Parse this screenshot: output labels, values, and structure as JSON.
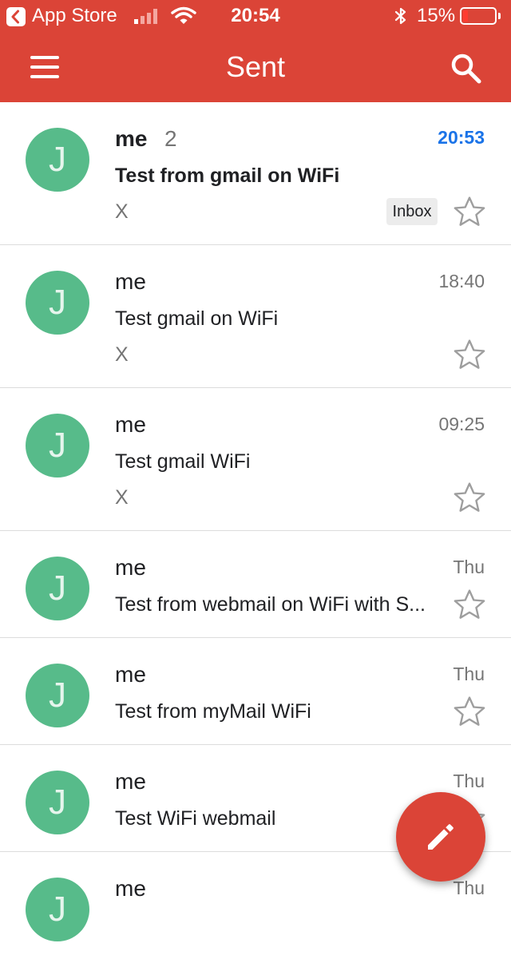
{
  "status_bar": {
    "back_app": "App Store",
    "time": "20:54",
    "battery_percent": "15%",
    "icons": [
      "back-icon",
      "signal-icon",
      "wifi-icon",
      "bluetooth-icon",
      "battery-icon"
    ]
  },
  "app_bar": {
    "title": "Sent",
    "icons": [
      "menu-icon",
      "search-icon"
    ],
    "color": "#db4437"
  },
  "emails": [
    {
      "sender": "me",
      "count": "2",
      "time": "20:53",
      "subject": "Test from gmail on WiFi",
      "snippet": "X",
      "label": "Inbox",
      "unread": true
    },
    {
      "sender": "me",
      "count": "",
      "time": "18:40",
      "subject": "Test gmail on WiFi",
      "snippet": "X",
      "label": "",
      "unread": false
    },
    {
      "sender": "me",
      "count": "",
      "time": "09:25",
      "subject": "Test gmail WiFi",
      "snippet": "X",
      "label": "",
      "unread": false
    },
    {
      "sender": "me",
      "count": "",
      "time": "Thu",
      "subject": "Test from webmail on WiFi with S...",
      "snippet": "",
      "label": "",
      "unread": false
    },
    {
      "sender": "me",
      "count": "",
      "time": "Thu",
      "subject": "Test from myMail WiFi",
      "snippet": "",
      "label": "",
      "unread": false
    },
    {
      "sender": "me",
      "count": "",
      "time": "Thu",
      "subject": "Test WiFi webmail",
      "snippet": "",
      "label": "",
      "unread": false
    },
    {
      "sender": "me",
      "count": "",
      "time": "Thu",
      "subject": "",
      "snippet": "",
      "label": "",
      "unread": false
    }
  ],
  "avatar_initial": "J",
  "avatar_color": "#57bb8a",
  "fab": {
    "icon": "pencil-icon"
  }
}
